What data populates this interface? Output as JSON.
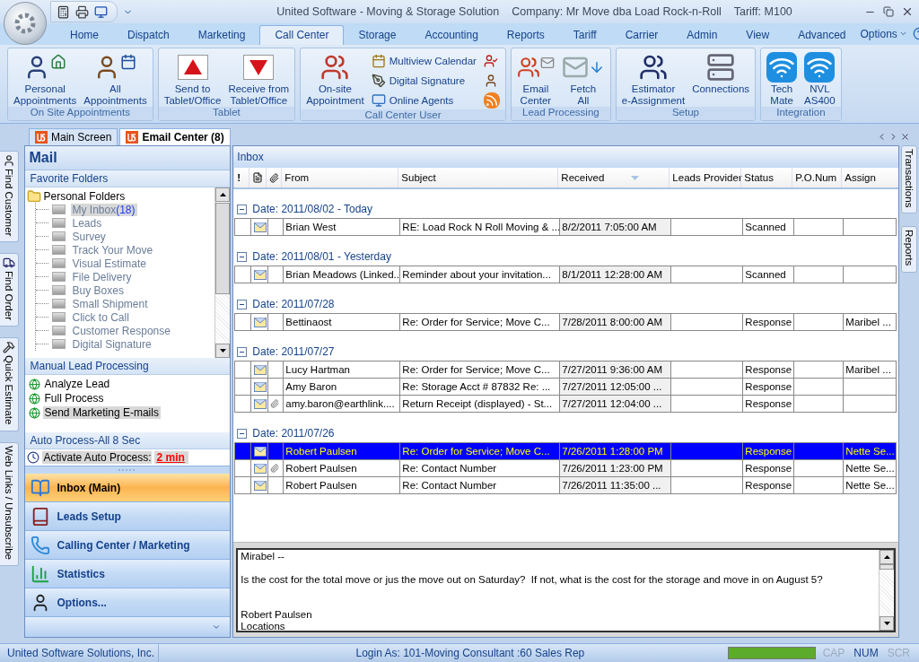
{
  "window": {
    "title": "United Software - Moving & Storage Solution",
    "company": "Company: Mr Move dba Load Rock-n-Roll",
    "tariff": "Tariff: M100"
  },
  "ribbon_tabs": [
    {
      "label": "Home",
      "selected": false
    },
    {
      "label": "Dispatch",
      "selected": false
    },
    {
      "label": "Marketing",
      "selected": false
    },
    {
      "label": "Call Center",
      "selected": true
    },
    {
      "label": "Storage",
      "selected": false
    },
    {
      "label": "Accounting",
      "selected": false
    },
    {
      "label": "Reports",
      "selected": false
    },
    {
      "label": "Tariff",
      "selected": false
    },
    {
      "label": "Carrier",
      "selected": false
    },
    {
      "label": "Admin",
      "selected": false
    },
    {
      "label": "View",
      "selected": false
    },
    {
      "label": "Advanced",
      "selected": false
    }
  ],
  "options_menu": "Options",
  "ribbon_groups": [
    {
      "title": "On Site Appointments",
      "buttons": [
        {
          "kind": "large",
          "lines": [
            "Personal",
            "Appointments"
          ]
        },
        {
          "kind": "large",
          "lines": [
            "All",
            "Appointments"
          ]
        }
      ]
    },
    {
      "title": "Tablet",
      "buttons": [
        {
          "kind": "large",
          "lines": [
            "Send to",
            "Tablet/Office"
          ]
        },
        {
          "kind": "large",
          "lines": [
            "Receive from",
            "Tablet/Office"
          ]
        }
      ]
    },
    {
      "title": "Call Center User",
      "buttons": [
        {
          "kind": "large",
          "lines": [
            "On-site",
            "Appointment"
          ]
        },
        {
          "kind": "small",
          "label": "Multiview Calendar"
        },
        {
          "kind": "small",
          "label": "Digital Signature"
        },
        {
          "kind": "small",
          "label": "Online Agents"
        },
        {
          "kind": "icon"
        },
        {
          "kind": "icon"
        },
        {
          "kind": "icon"
        }
      ]
    },
    {
      "title": "Lead Processing",
      "buttons": [
        {
          "kind": "large",
          "lines": [
            "Email",
            "Center"
          ]
        },
        {
          "kind": "large",
          "lines": [
            "Fetch",
            "All"
          ]
        }
      ]
    },
    {
      "title": "Setup",
      "buttons": [
        {
          "kind": "large",
          "lines": [
            "Estimator",
            "e-Assignment"
          ]
        },
        {
          "kind": "large",
          "lines": [
            "Connections"
          ]
        }
      ]
    },
    {
      "title": "Integration",
      "buttons": [
        {
          "kind": "large",
          "lines": [
            "Tech",
            "Mate"
          ]
        },
        {
          "kind": "large",
          "lines": [
            "NVL",
            "AS400"
          ]
        }
      ]
    }
  ],
  "doc_tabs": [
    {
      "label": "Main Screen",
      "selected": false
    },
    {
      "label": "Email Center (8)",
      "selected": true
    }
  ],
  "side_tabs": [
    "Find Customer",
    "Find Order",
    "Quick Estimate",
    "Web Links / Unsubscribe"
  ],
  "right_tabs": [
    "Transactions",
    "Reports"
  ],
  "mail": {
    "title": "Mail",
    "favorites_header": "Favorite Folders",
    "tree": {
      "label": "Personal Folders",
      "children": [
        {
          "label": "My Inbox",
          "count": "(18)",
          "selected": true
        },
        {
          "label": "Leads",
          "selected": false
        },
        {
          "label": "Survey",
          "selected": false
        },
        {
          "label": "Track Your Move",
          "selected": false
        },
        {
          "label": "Visual Estimate",
          "selected": false
        },
        {
          "label": "File Delivery",
          "selected": false
        },
        {
          "label": "Buy Boxes",
          "selected": false
        },
        {
          "label": "Small Shipment",
          "selected": false
        },
        {
          "label": "Click to Call",
          "selected": false
        },
        {
          "label": "Customer Response",
          "selected": false
        },
        {
          "label": "Digital Signature",
          "selected": false
        }
      ]
    },
    "manual_header": "Manual Lead Processing",
    "manual_items": [
      {
        "label": "Analyze Lead",
        "selected": false
      },
      {
        "label": "Full Process",
        "selected": false
      },
      {
        "label": "Send Marketing E-mails",
        "selected": true
      }
    ],
    "auto_header": "Auto Process-All  8 Sec",
    "auto_label": "Activate Auto Process:",
    "auto_value": "2 min",
    "nav": [
      {
        "label": "Inbox (Main)",
        "selected": true
      },
      {
        "label": "Leads Setup",
        "selected": false
      },
      {
        "label": "Calling Center / Marketing",
        "selected": false
      },
      {
        "label": "Statistics",
        "selected": false
      },
      {
        "label": "Options...",
        "selected": false
      }
    ]
  },
  "inbox": {
    "title": "Inbox",
    "columns": [
      {
        "kind": "text",
        "label": "!",
        "sorted": false
      },
      {
        "kind": "page-icon"
      },
      {
        "kind": "clip-icon"
      },
      {
        "kind": "text",
        "label": "From",
        "sorted": false
      },
      {
        "kind": "text",
        "label": "Subject",
        "sorted": false
      },
      {
        "kind": "text",
        "label": "Received",
        "sorted": true
      },
      {
        "kind": "text",
        "label": "Leads Provider",
        "sorted": false
      },
      {
        "kind": "text",
        "label": "Status",
        "sorted": false
      },
      {
        "kind": "text",
        "label": "P.O.Num",
        "sorted": false
      },
      {
        "kind": "text",
        "label": "Assign",
        "sorted": false
      }
    ],
    "groups": [
      {
        "label": "Date: 2011/08/02 - Today",
        "expanded": true,
        "rows": [
          {
            "from": "Brian West",
            "subject": "RE: Load Rock N Roll Moving & ...",
            "received": "8/2/2011 7:05:00 AM",
            "status": "Scanned",
            "assign": "",
            "attachment": false,
            "selected": false
          }
        ]
      },
      {
        "label": "Date: 2011/08/01 - Yesterday",
        "expanded": true,
        "rows": [
          {
            "from": "Brian Meadows (Linked...",
            "subject": "Reminder about your invitation...",
            "received": "8/1/2011 12:28:00 AM",
            "status": "Scanned",
            "assign": "",
            "attachment": false,
            "selected": false
          }
        ]
      },
      {
        "label": "Date: 2011/07/28",
        "expanded": true,
        "rows": [
          {
            "from": "Bettinaost",
            "subject": "Re: Order for Service; Move C...",
            "received": "7/28/2011 8:00:00 AM",
            "status": "Response",
            "assign": "Maribel ...",
            "attachment": false,
            "selected": false
          }
        ]
      },
      {
        "label": "Date: 2011/07/27",
        "expanded": true,
        "rows": [
          {
            "from": "Lucy Hartman",
            "subject": "Re: Order for Service; Move C...",
            "received": "7/27/2011 9:36:00 AM",
            "status": "Response",
            "assign": "Maribel ...",
            "attachment": false,
            "selected": false
          },
          {
            "from": "Amy Baron",
            "subject": "Re: Storage Acct # 87832 Re: ...",
            "received": "7/27/2011 12:05:00 ...",
            "status": "Response",
            "assign": "",
            "attachment": false,
            "selected": false
          },
          {
            "from": "amy.baron@earthlink....",
            "subject": "Return Receipt (displayed) - St...",
            "received": "7/27/2011 12:04:00 ...",
            "status": "Response",
            "assign": "",
            "attachment": true,
            "selected": false
          }
        ]
      },
      {
        "label": "Date: 2011/07/26",
        "expanded": true,
        "rows": [
          {
            "from": "Robert Paulsen",
            "subject": "Re: Order for Service; Move C...",
            "received": "7/26/2011 1:28:00 PM",
            "status": "Response",
            "assign": "Nette Se...",
            "attachment": false,
            "selected": true
          },
          {
            "from": "Robert Paulsen",
            "subject": "Re: Contact Number",
            "received": "7/26/2011 1:23:00 PM",
            "status": "Response",
            "assign": "Nette Se...",
            "attachment": true,
            "selected": false
          },
          {
            "from": "Robert Paulsen",
            "subject": "Re: Contact Number",
            "received": "7/26/2011 11:35:00 ...",
            "status": "Response",
            "assign": "Nette Se...",
            "attachment": false,
            "selected": false
          }
        ]
      }
    ],
    "preview": "Mirabel --\n\nIs the cost for the total move or jus the move out on Saturday?  If not, what is the cost for the storage and move in on August 5?\n\n\nRobert Paulsen\nLocations"
  },
  "status_bar": {
    "company": "United Software Solutions, Inc.",
    "login": "Login As: 101-Moving Consultant :60  Sales Rep",
    "level": 1,
    "indicators": [
      {
        "label": "CAP",
        "on": false
      },
      {
        "label": "NUM",
        "on": true
      },
      {
        "label": "SCR",
        "on": false
      }
    ]
  }
}
